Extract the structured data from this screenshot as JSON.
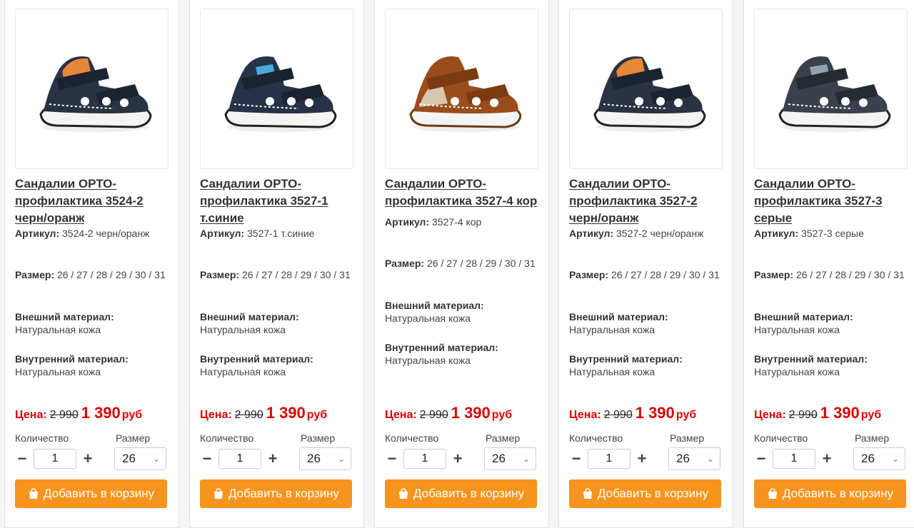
{
  "labels": {
    "article": "Артикул:",
    "size": "Размер:",
    "outer": "Внешний материал:",
    "inner": "Внутренний материал:",
    "price": "Цена:",
    "qty": "Количество",
    "size_select": "Размер",
    "cart": "Добавить в корзину",
    "currency": "руб"
  },
  "colors": {
    "accent": "#f7941d",
    "price": "#e00000"
  },
  "products": [
    {
      "title": "Сандалии ОРТО-профилактика 3524-2 черн/оранж",
      "article": "3524-2 черн/оранж",
      "sizes": "26 / 27 / 28 / 29 / 30 / 31",
      "outer": "Натуральная кожа",
      "inner": "Натуральная кожа",
      "old_price": "2 990",
      "new_price": "1 390",
      "qty": "1",
      "size": "26",
      "shoe": {
        "base": "#2a3344",
        "accent": "#e8873a"
      }
    },
    {
      "title": "Сандалии ОРТО-профилактика 3527-1 т.синие",
      "article": "3527-1 т.синие",
      "sizes": "26 / 27 / 28 / 29 / 30 / 31",
      "outer": "Натуральная кожа",
      "inner": "Натуральная кожа",
      "old_price": "2 990",
      "new_price": "1 390",
      "qty": "1",
      "size": "26",
      "shoe": {
        "base": "#263248",
        "accent": "#4aa8e0"
      }
    },
    {
      "title": "Сандалии ОРТО-профилактика 3527-4 кор",
      "article": "3527-4 кор",
      "sizes": "26 / 27 / 28 / 29 / 30 / 31",
      "outer": "Натуральная кожа",
      "inner": "Натуральная кожа",
      "old_price": "2 990",
      "new_price": "1 390",
      "qty": "1",
      "size": "26",
      "shoe": {
        "base": "#9a4d1c",
        "accent": "#d9c8b0"
      }
    },
    {
      "title": "Сандалии ОРТО-профилактика 3527-2 черн/оранж",
      "article": "3527-2 черн/оранж",
      "sizes": "26 / 27 / 28 / 29 / 30 / 31",
      "outer": "Натуральная кожа",
      "inner": "Натуральная кожа",
      "old_price": "2 990",
      "new_price": "1 390",
      "qty": "1",
      "size": "26",
      "shoe": {
        "base": "#2a3344",
        "accent": "#e8873a"
      }
    },
    {
      "title": "Сандалии ОРТО-профилактика 3527-3 серые",
      "article": "3527-3 серые",
      "sizes": "26 / 27 / 28 / 29 / 30 / 31",
      "outer": "Натуральная кожа",
      "inner": "Натуральная кожа",
      "old_price": "2 990",
      "new_price": "1 390",
      "qty": "1",
      "size": "26",
      "shoe": {
        "base": "#3a414c",
        "accent": "#8fa3b0"
      }
    }
  ]
}
